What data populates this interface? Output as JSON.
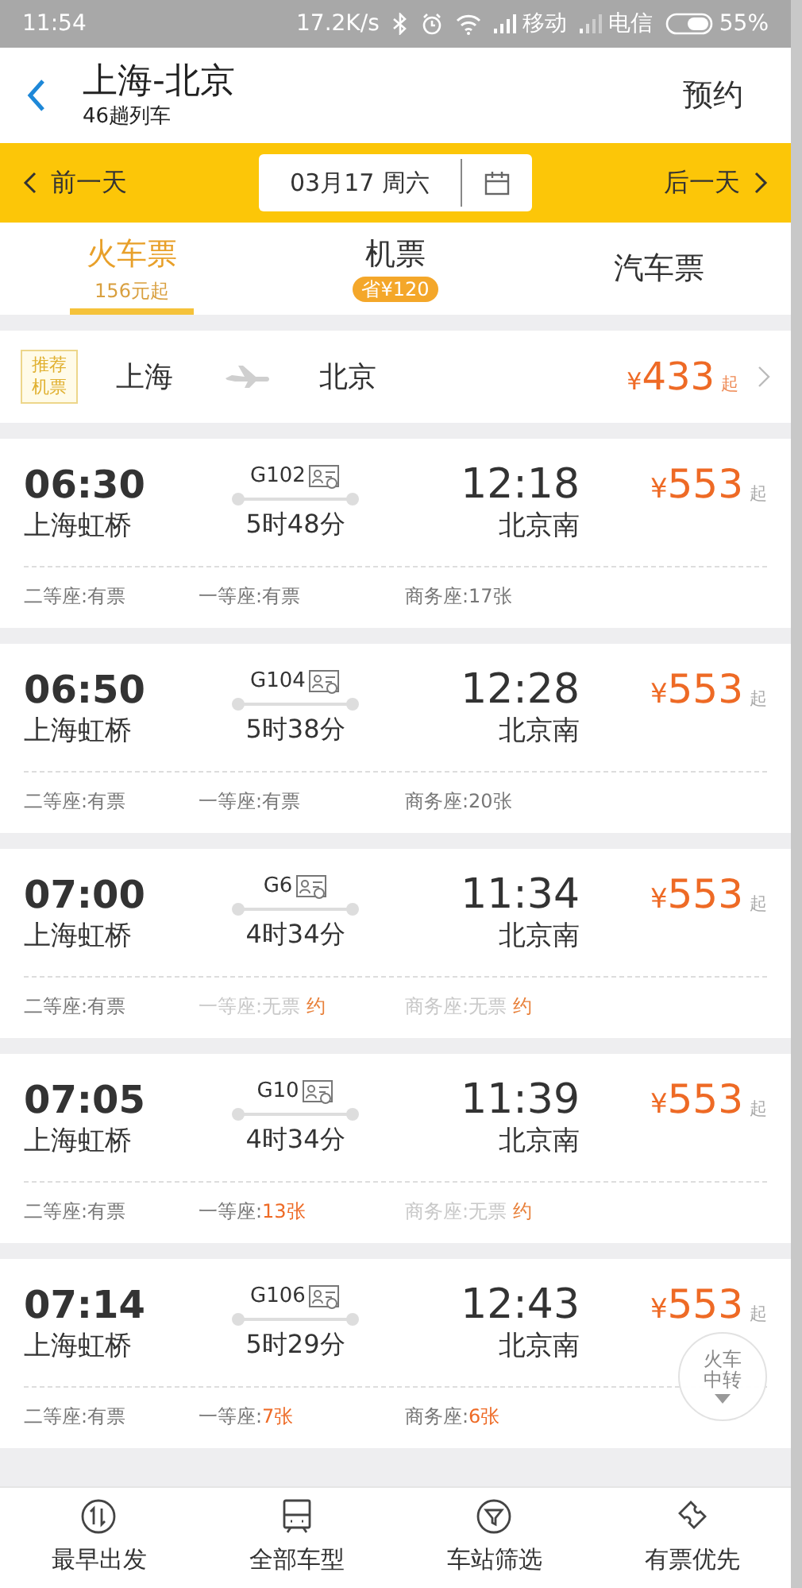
{
  "status_bar": {
    "time": "11:54",
    "speed": "17.2K/s",
    "carrier_1": "移动",
    "carrier_2": "电信",
    "battery": "55%"
  },
  "header": {
    "title": "上海-北京",
    "subtitle": "46趟列车",
    "action": "预约"
  },
  "date_bar": {
    "prev": "前一天",
    "date": "03月17 周六",
    "next": "后一天"
  },
  "tabs": [
    {
      "label": "火车票",
      "sub": "156元起",
      "kind": "text",
      "selected": true
    },
    {
      "label": "机票",
      "sub": "省¥120",
      "kind": "badge",
      "selected": false
    },
    {
      "label": "汽车票",
      "selected": false
    }
  ],
  "flight_card": {
    "tag": "推荐机票",
    "from": "上海",
    "to": "北京",
    "price": "433",
    "currency": "¥",
    "suffix": "起"
  },
  "trains": [
    {
      "depart": "06:30",
      "from": "上海虹桥",
      "number": "G102",
      "duration": "5时48分",
      "arrive": "12:18",
      "to": "北京南",
      "currency": "¥",
      "price": "553",
      "suffix": "起",
      "seats": [
        {
          "kind": "plain",
          "label": "二等座:有票"
        },
        {
          "kind": "plain",
          "label": "一等座:有票"
        },
        {
          "kind": "plain",
          "label": "商务座:17张"
        }
      ]
    },
    {
      "depart": "06:50",
      "from": "上海虹桥",
      "number": "G104",
      "duration": "5时38分",
      "arrive": "12:28",
      "to": "北京南",
      "currency": "¥",
      "price": "553",
      "suffix": "起",
      "seats": [
        {
          "kind": "plain",
          "label": "二等座:有票"
        },
        {
          "kind": "plain",
          "label": "一等座:有票"
        },
        {
          "kind": "plain",
          "label": "商务座:20张"
        }
      ]
    },
    {
      "depart": "07:00",
      "from": "上海虹桥",
      "number": "G6",
      "duration": "4时34分",
      "arrive": "11:34",
      "to": "北京南",
      "currency": "¥",
      "price": "553",
      "suffix": "起",
      "seats": [
        {
          "kind": "plain",
          "label": "二等座:有票"
        },
        {
          "kind": "none",
          "label": "一等座:无票",
          "action": "约"
        },
        {
          "kind": "none",
          "label": "商务座:无票",
          "action": "约"
        }
      ]
    },
    {
      "depart": "07:05",
      "from": "上海虹桥",
      "number": "G10",
      "duration": "4时34分",
      "arrive": "11:39",
      "to": "北京南",
      "currency": "¥",
      "price": "553",
      "suffix": "起",
      "seats": [
        {
          "kind": "plain",
          "label": "二等座:有票"
        },
        {
          "kind": "count",
          "label": "一等座:",
          "value": "13张"
        },
        {
          "kind": "none",
          "label": "商务座:无票",
          "action": "约"
        }
      ]
    },
    {
      "depart": "07:14",
      "from": "上海虹桥",
      "number": "G106",
      "duration": "5时29分",
      "arrive": "12:43",
      "to": "北京南",
      "currency": "¥",
      "price": "553",
      "suffix": "起",
      "seats": [
        {
          "kind": "plain",
          "label": "二等座:有票"
        },
        {
          "kind": "count",
          "label": "一等座:",
          "value": "7张"
        },
        {
          "kind": "count",
          "label": "商务座:",
          "value": "6张"
        }
      ]
    }
  ],
  "float_button": {
    "label": "火车中转"
  },
  "bottom_nav": [
    {
      "label": "最早出发"
    },
    {
      "label": "全部车型"
    },
    {
      "label": "车站筛选"
    },
    {
      "label": "有票优先"
    }
  ]
}
